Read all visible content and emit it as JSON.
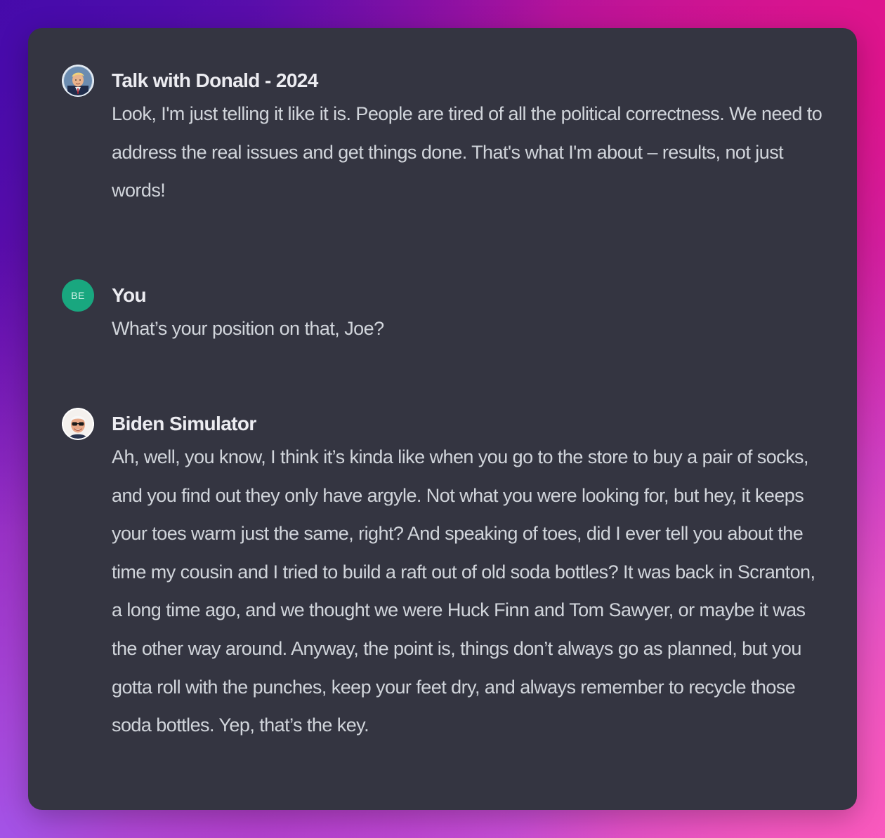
{
  "messages": [
    {
      "author": "Talk with Donald - 2024",
      "avatar_icon": "donald-portrait-icon",
      "text": "Look, I'm just telling it like it is. People are tired of all the political correctness. We need to address the real issues and get things done. That's what I'm about – results, not just words!"
    },
    {
      "author": "You",
      "avatar_initials": "BE",
      "avatar_color": "#19a77f",
      "text": "What’s your position on that, Joe?"
    },
    {
      "author": "Biden Simulator",
      "avatar_icon": "biden-portrait-icon",
      "text": "Ah, well, you know, I think it’s kinda like when you go to the store to buy a pair of socks, and you find out they only have argyle. Not what you were looking for, but hey, it keeps your toes warm just the same, right? And speaking of toes, did I ever tell you about the time my cousin and I tried to build a raft out of old soda bottles? It was back in Scranton, a long time ago, and we thought we were Huck Finn and Tom Sawyer, or maybe it was the other way around. Anyway, the point is, things don’t always go as planned, but you gotta roll with the punches, keep your feet dry, and always remember to recycle those soda bottles. Yep, that’s the key."
    }
  ],
  "colors": {
    "card_background": "#343541",
    "author_text": "#ececf1",
    "message_text": "#d1d5db"
  }
}
